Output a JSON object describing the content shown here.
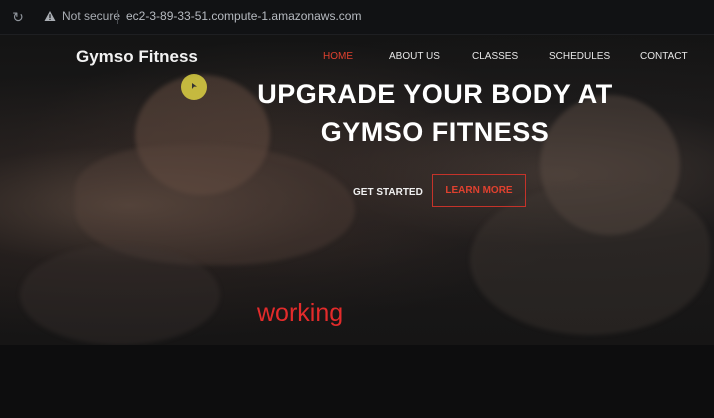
{
  "browser": {
    "security_label": "Not secure",
    "url": "ec2-3-89-33-51.compute-1.amazonaws.com"
  },
  "site": {
    "brand": "Gymso Fitness",
    "nav": [
      {
        "label": "HOME",
        "active": true
      },
      {
        "label": "ABOUT US",
        "active": false
      },
      {
        "label": "CLASSES",
        "active": false
      },
      {
        "label": "SCHEDULES",
        "active": false
      },
      {
        "label": "CONTACT",
        "active": false
      }
    ],
    "accent_color": "#e0412f"
  },
  "hero": {
    "headline_line1": "UPGRADE YOUR BODY AT",
    "headline_line2": "GYMSO FITNESS",
    "primary_cta": "GET STARTED",
    "secondary_cta": "LEARN MORE"
  },
  "overlay": {
    "caption": "working",
    "caption_color": "#e32b2b"
  }
}
